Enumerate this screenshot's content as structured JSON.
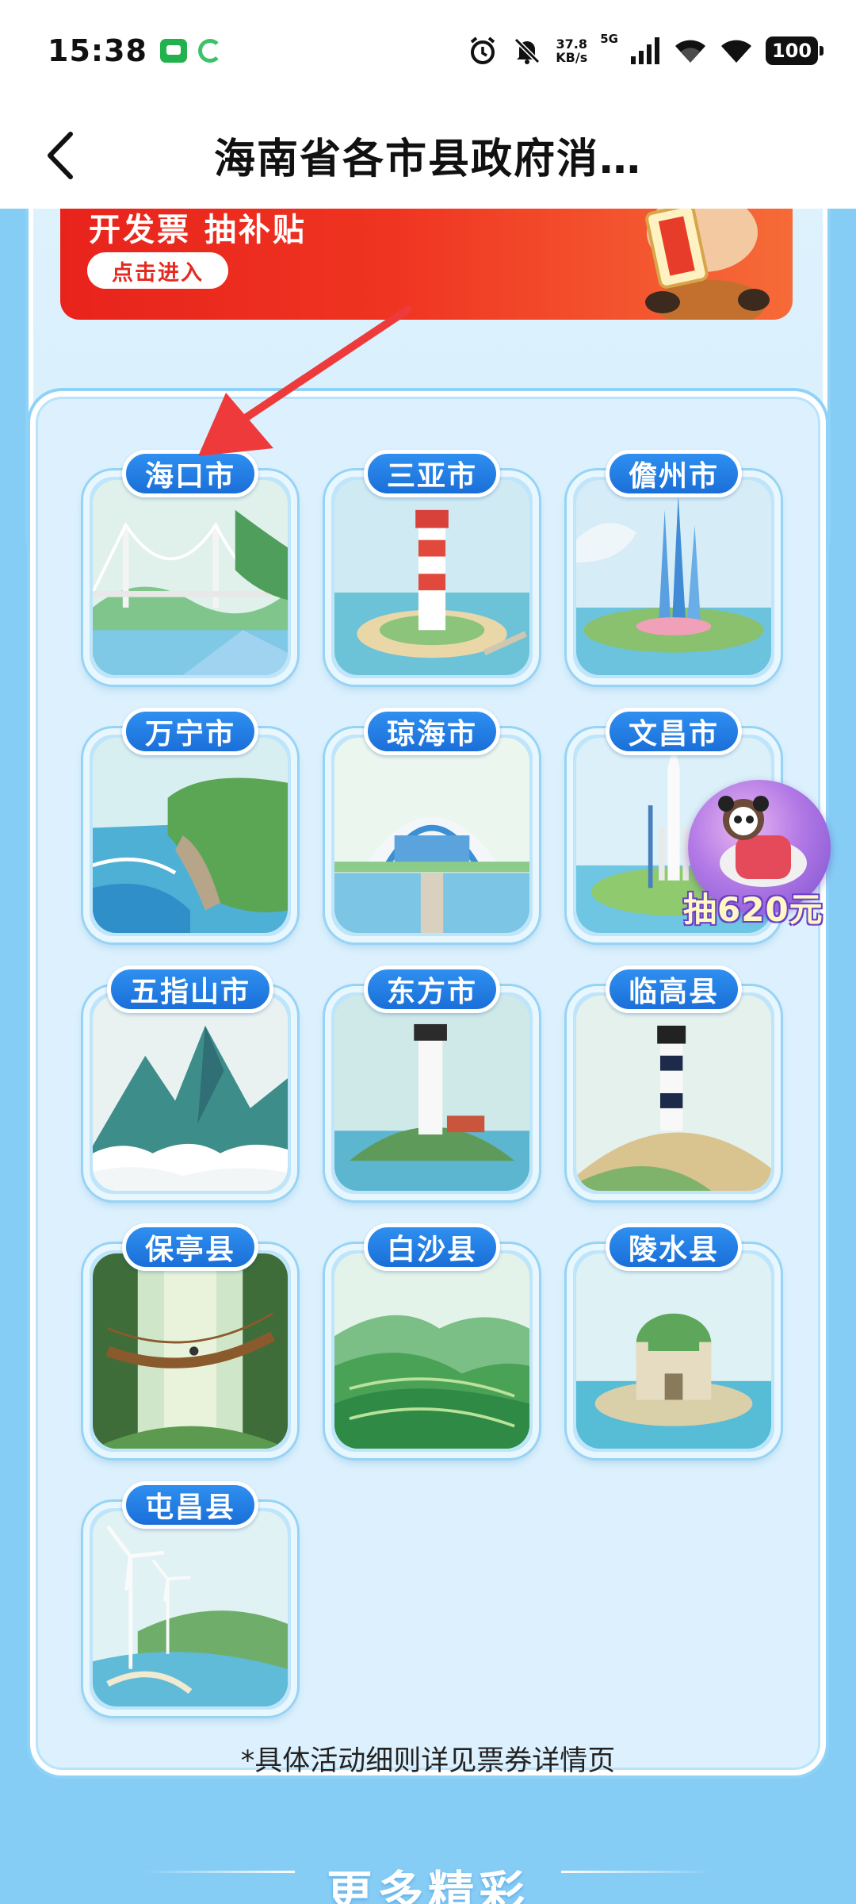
{
  "status_bar": {
    "time": "15:38",
    "speed_value": "37.8",
    "speed_unit": "KB/s",
    "network": "5G",
    "battery": "100"
  },
  "nav": {
    "title": "海南省各市县政府消…"
  },
  "promo": {
    "headline": "开发票 抽补贴",
    "enter_label": "点击进入"
  },
  "regions": [
    {
      "label": "海口市",
      "scene": "bridge"
    },
    {
      "label": "三亚市",
      "scene": "lighthouse-red"
    },
    {
      "label": "儋州市",
      "scene": "towers"
    },
    {
      "label": "万宁市",
      "scene": "cliffs"
    },
    {
      "label": "琼海市",
      "scene": "forum"
    },
    {
      "label": "文昌市",
      "scene": "rocket"
    },
    {
      "label": "五指山市",
      "scene": "mountains"
    },
    {
      "label": "东方市",
      "scene": "lighthouse-white"
    },
    {
      "label": "临高县",
      "scene": "lighthouse-striped"
    },
    {
      "label": "保亭县",
      "scene": "rope-bridge"
    },
    {
      "label": "白沙县",
      "scene": "tea-hills"
    },
    {
      "label": "陵水县",
      "scene": "castle-island"
    },
    {
      "label": "屯昌县",
      "scene": "wind-farm"
    }
  ],
  "float_widget": {
    "amount_label": "抽620元"
  },
  "disclaimer": "*具体活动细则详见票券详情页",
  "more": {
    "title": "更多精彩"
  }
}
